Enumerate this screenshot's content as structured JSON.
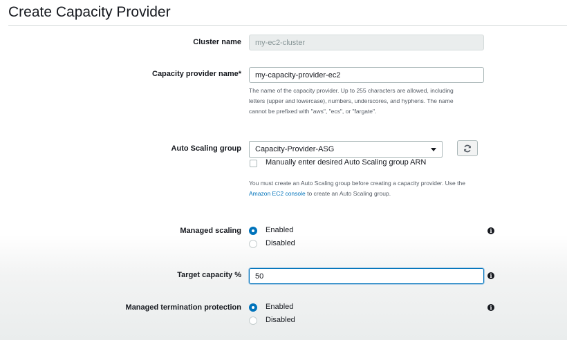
{
  "page": {
    "title": "Create Capacity Provider"
  },
  "cluster_name": {
    "label": "Cluster name",
    "value": "my-ec2-cluster"
  },
  "capacity_provider_name": {
    "label": "Capacity provider name*",
    "value": "my-capacity-provider-ec2",
    "help_line1": "The name of the capacity provider. Up to 255 characters are allowed, including",
    "help_line2": "letters (upper and lowercase), numbers, underscores, and hyphens. The name",
    "help_line3": "cannot be prefixed with \"aws\", \"ecs\", or \"fargate\"."
  },
  "auto_scaling_group": {
    "label": "Auto Scaling group",
    "selected": "Capacity-Provider-ASG",
    "manual_arn_label": "Manually enter desired Auto Scaling group ARN",
    "help_line1": "You must create an Auto Scaling group before creating a capacity provider. Use the",
    "help_link": "Amazon EC2 console",
    "help_line2_rest": " to create an Auto Scaling group.",
    "refresh_icon": "refresh-icon"
  },
  "managed_scaling": {
    "label": "Managed scaling",
    "options": [
      "Enabled",
      "Disabled"
    ],
    "selected": "Enabled"
  },
  "target_capacity": {
    "label": "Target capacity %",
    "value": "50"
  },
  "managed_termination_protection": {
    "label": "Managed termination protection",
    "options": [
      "Enabled",
      "Disabled"
    ],
    "selected": "Enabled"
  },
  "colors": {
    "accent": "#0073bb",
    "text": "#16191f",
    "muted": "#545b64",
    "border": "#aab7b8"
  }
}
